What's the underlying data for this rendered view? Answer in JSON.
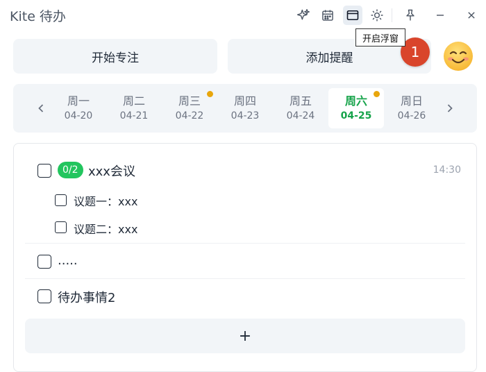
{
  "window": {
    "title": "Kite 待办",
    "tooltip": "开启浮窗"
  },
  "toolbar": {
    "icons": [
      "sparkle-icon",
      "calendar-icon",
      "window-icon",
      "sun-icon",
      "pin-icon",
      "minimize-icon",
      "close-icon"
    ]
  },
  "actions": {
    "focus_label": "开始专注",
    "remind_label": "添加提醒",
    "notification_count": "1"
  },
  "week": {
    "days": [
      {
        "name": "周一",
        "date": "04-20",
        "dot": false,
        "selected": false
      },
      {
        "name": "周二",
        "date": "04-21",
        "dot": false,
        "selected": false
      },
      {
        "name": "周三",
        "date": "04-22",
        "dot": true,
        "selected": false
      },
      {
        "name": "周四",
        "date": "04-23",
        "dot": false,
        "selected": false
      },
      {
        "name": "周五",
        "date": "04-24",
        "dot": false,
        "selected": false
      },
      {
        "name": "周六",
        "date": "04-25",
        "dot": true,
        "selected": true
      },
      {
        "name": "周日",
        "date": "04-26",
        "dot": false,
        "selected": false
      }
    ]
  },
  "tasks": [
    {
      "title": "xxx会议",
      "progress": "0/2",
      "time": "14:30",
      "subtasks": [
        "议题一：xxx",
        "议题二：xxx"
      ]
    },
    {
      "title": "....."
    },
    {
      "title": "待办事情2"
    }
  ],
  "add_label": "+",
  "colors": {
    "accent": "#22c55e",
    "selected_day": "#16a34a",
    "dot": "#e8a60c",
    "badge": "#d9452b",
    "panel": "#f2f5f8"
  }
}
